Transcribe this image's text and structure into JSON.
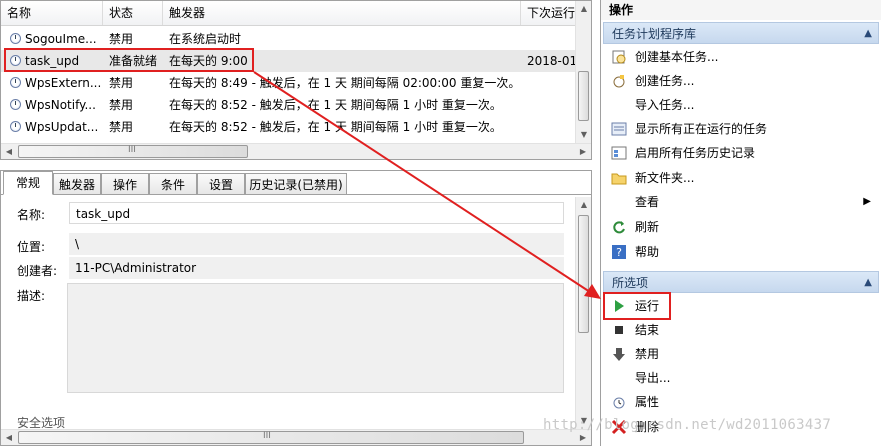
{
  "tasklist": {
    "columns": [
      "名称",
      "状态",
      "触发器",
      "下次运行"
    ],
    "rows": [
      {
        "name": "SogouIme...",
        "status": "禁用",
        "trigger": "在系统启动时",
        "next": ""
      },
      {
        "name": "task_upd",
        "status": "准备就绪",
        "trigger": "在每天的 9:00",
        "next": "2018-01"
      },
      {
        "name": "WpsExtern...",
        "status": "禁用",
        "trigger": "在每天的 8:49 - 触发后，在 1 天 期间每隔 02:00:00 重复一次。",
        "next": ""
      },
      {
        "name": "WpsNotify...",
        "status": "禁用",
        "trigger": "在每天的 8:52 - 触发后，在 1 天 期间每隔 1 小时 重复一次。",
        "next": ""
      },
      {
        "name": "WpsUpdat...",
        "status": "禁用",
        "trigger": "在每天的 8:52 - 触发后，在 1 天 期间每隔 1 小时 重复一次。",
        "next": ""
      }
    ],
    "hscroll_grip": "III"
  },
  "details": {
    "tabs": [
      "常规",
      "触发器",
      "操作",
      "条件",
      "设置",
      "历史记录(已禁用)"
    ],
    "fields": {
      "name_label": "名称:",
      "name_value": "task_upd",
      "location_label": "位置:",
      "location_value": "\\",
      "author_label": "创建者:",
      "author_value": "11-PC\\Administrator",
      "desc_label": "描述:"
    },
    "partial_label": "安全选项",
    "hscroll_grip": "III"
  },
  "actions": {
    "title": "操作",
    "library_section": "任务计划程序库",
    "library_items": [
      {
        "label": "创建基本任务...",
        "icon": "create-basic-task-icon"
      },
      {
        "label": "创建任务...",
        "icon": "create-task-icon"
      },
      {
        "label": "导入任务...",
        "icon": ""
      },
      {
        "label": "显示所有正在运行的任务",
        "icon": "running-tasks-icon"
      },
      {
        "label": "启用所有任务历史记录",
        "icon": "history-icon"
      },
      {
        "label": "新文件夹...",
        "icon": "folder-icon"
      },
      {
        "label": "查看",
        "icon": ""
      },
      {
        "label": "刷新",
        "icon": "refresh-icon"
      },
      {
        "label": "帮助",
        "icon": "help-icon"
      }
    ],
    "selected_section": "所选项",
    "selected_items": [
      {
        "label": "运行",
        "icon": "run-icon"
      },
      {
        "label": "结束",
        "icon": "stop-icon"
      },
      {
        "label": "禁用",
        "icon": "disable-icon"
      },
      {
        "label": "导出...",
        "icon": ""
      },
      {
        "label": "属性",
        "icon": "properties-icon"
      },
      {
        "label": "删除",
        "icon": "delete-icon"
      }
    ]
  },
  "watermark": "http://blog.csdn.net/wd2011063437",
  "colors": {
    "highlight": "#e02020",
    "section_bg": "#c6d8ee",
    "selected_row": "#e8e8e8"
  }
}
